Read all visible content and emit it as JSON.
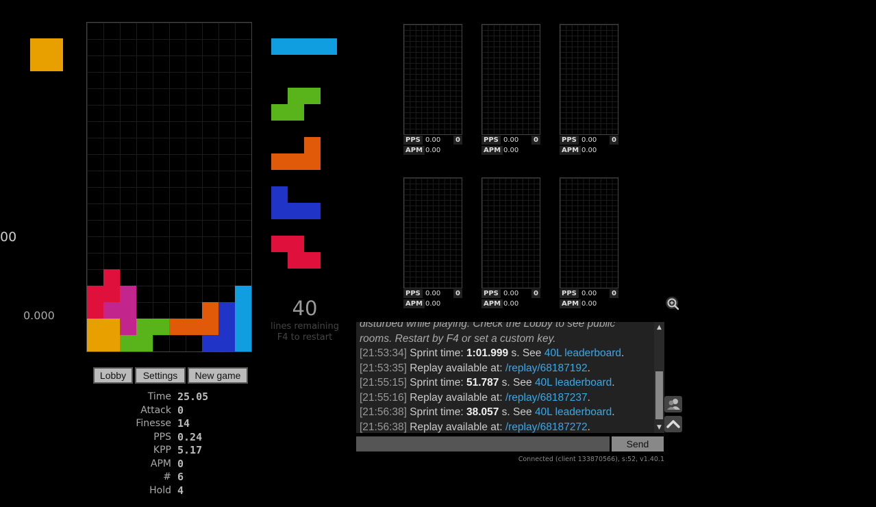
{
  "game": {
    "hold_color": "#e8a000",
    "left_cut_text": "00",
    "left_zero_text": "0.000",
    "lines_remaining_number": "40",
    "lines_remaining_label": "lines remaining",
    "restart_hint": "F4 to restart",
    "board_cells": [
      {
        "c": 1,
        "r": 15,
        "color": "#e0103c"
      },
      {
        "c": 0,
        "r": 16,
        "color": "#e0103c"
      },
      {
        "c": 1,
        "r": 16,
        "color": "#e0103c"
      },
      {
        "c": 2,
        "r": 16,
        "color": "#c2268c"
      },
      {
        "c": 0,
        "r": 17,
        "color": "#e0103c"
      },
      {
        "c": 1,
        "r": 17,
        "color": "#c2268c"
      },
      {
        "c": 2,
        "r": 17,
        "color": "#c2268c"
      },
      {
        "c": 9,
        "r": 16,
        "color": "#109ee0"
      },
      {
        "c": 9,
        "r": 17,
        "color": "#109ee0"
      },
      {
        "c": 8,
        "r": 17,
        "color": "#2034c8"
      },
      {
        "c": 7,
        "r": 17,
        "color": "#e05a0a"
      },
      {
        "c": 0,
        "r": 18,
        "color": "#e8a000"
      },
      {
        "c": 1,
        "r": 18,
        "color": "#e8a000"
      },
      {
        "c": 2,
        "r": 18,
        "color": "#c2268c"
      },
      {
        "c": 3,
        "r": 18,
        "color": "#58b41a"
      },
      {
        "c": 4,
        "r": 18,
        "color": "#58b41a"
      },
      {
        "c": 5,
        "r": 18,
        "color": "#e05a0a"
      },
      {
        "c": 6,
        "r": 18,
        "color": "#e05a0a"
      },
      {
        "c": 7,
        "r": 18,
        "color": "#e05a0a"
      },
      {
        "c": 8,
        "r": 18,
        "color": "#2034c8"
      },
      {
        "c": 9,
        "r": 18,
        "color": "#109ee0"
      },
      {
        "c": 0,
        "r": 19,
        "color": "#e8a000"
      },
      {
        "c": 1,
        "r": 19,
        "color": "#e8a000"
      },
      {
        "c": 2,
        "r": 19,
        "color": "#58b41a"
      },
      {
        "c": 3,
        "r": 19,
        "color": "#58b41a"
      },
      {
        "c": 7,
        "r": 19,
        "color": "#2034c8"
      },
      {
        "c": 8,
        "r": 19,
        "color": "#2034c8"
      },
      {
        "c": 9,
        "r": 19,
        "color": "#109ee0"
      }
    ],
    "next_queue": [
      {
        "name": "I",
        "color": "#109ee0",
        "cells": [
          [
            0,
            0
          ],
          [
            1,
            0
          ],
          [
            2,
            0
          ],
          [
            3,
            0
          ]
        ]
      },
      {
        "name": "S",
        "color": "#58b41a",
        "cells": [
          [
            1,
            0
          ],
          [
            2,
            0
          ],
          [
            0,
            1
          ],
          [
            1,
            1
          ]
        ]
      },
      {
        "name": "L",
        "color": "#e05a0a",
        "cells": [
          [
            2,
            0
          ],
          [
            0,
            1
          ],
          [
            1,
            1
          ],
          [
            2,
            1
          ]
        ]
      },
      {
        "name": "J",
        "color": "#2034c8",
        "cells": [
          [
            0,
            0
          ],
          [
            0,
            1
          ],
          [
            1,
            1
          ],
          [
            2,
            1
          ]
        ]
      },
      {
        "name": "Z",
        "color": "#e0103c",
        "cells": [
          [
            0,
            0
          ],
          [
            1,
            0
          ],
          [
            1,
            1
          ],
          [
            2,
            1
          ]
        ]
      }
    ]
  },
  "buttons": {
    "lobby": "Lobby",
    "settings": "Settings",
    "new_game": "New game"
  },
  "stats": [
    {
      "label": "Time",
      "value": "25.05"
    },
    {
      "label": "Attack",
      "value": "0"
    },
    {
      "label": "Finesse",
      "value": "14"
    },
    {
      "label": "PPS",
      "value": "0.24"
    },
    {
      "label": "KPP",
      "value": "5.17"
    },
    {
      "label": "APM",
      "value": "0"
    },
    {
      "label": "#",
      "value": "6"
    },
    {
      "label": "Hold",
      "value": "4"
    }
  ],
  "opponents": [
    {
      "pps_label": "PPS",
      "pps": "0.00",
      "apm_label": "APM",
      "apm": "0.00",
      "badge": "0"
    },
    {
      "pps_label": "PPS",
      "pps": "0.00",
      "apm_label": "APM",
      "apm": "0.00",
      "badge": "0"
    },
    {
      "pps_label": "PPS",
      "pps": "0.00",
      "apm_label": "APM",
      "apm": "0.00",
      "badge": "0"
    },
    {
      "pps_label": "PPS",
      "pps": "0.00",
      "apm_label": "APM",
      "apm": "0.00",
      "badge": "0"
    },
    {
      "pps_label": "PPS",
      "pps": "0.00",
      "apm_label": "APM",
      "apm": "0.00",
      "badge": "0"
    },
    {
      "pps_label": "PPS",
      "pps": "0.00",
      "apm_label": "APM",
      "apm": "0.00",
      "badge": "0"
    }
  ],
  "chat": {
    "intro_line1": "disturbed while playing. Check the Lobby to see public",
    "intro_line2": "rooms. Restart by F4 or set a custom key.",
    "messages": [
      {
        "time": "[21:53:34]",
        "pre": " Sprint time: ",
        "bold": "1:01.999",
        "mid": " s. See ",
        "link": "40L leaderboard",
        "post": "."
      },
      {
        "time": "[21:53:35]",
        "pre": " Replay available at: ",
        "bold": "",
        "mid": "",
        "link": "/replay/68187192",
        "post": "."
      },
      {
        "time": "[21:55:15]",
        "pre": " Sprint time: ",
        "bold": "51.787",
        "mid": " s. See ",
        "link": "40L leaderboard",
        "post": "."
      },
      {
        "time": "[21:55:16]",
        "pre": " Replay available at: ",
        "bold": "",
        "mid": "",
        "link": "/replay/68187237",
        "post": "."
      },
      {
        "time": "[21:56:38]",
        "pre": " Sprint time: ",
        "bold": "38.057",
        "mid": " s. See ",
        "link": "40L leaderboard",
        "post": "."
      },
      {
        "time": "[21:56:38]",
        "pre": " Replay available at: ",
        "bold": "",
        "mid": "",
        "link": "/replay/68187272",
        "post": "."
      }
    ],
    "send_label": "Send",
    "input_value": "",
    "status": "Connected (client 133870566), s:52, v1.40.1"
  },
  "icons": {
    "zoom": "magnifier-plus-icon",
    "users": "users-icon",
    "collapse": "chevron-up-icon"
  }
}
